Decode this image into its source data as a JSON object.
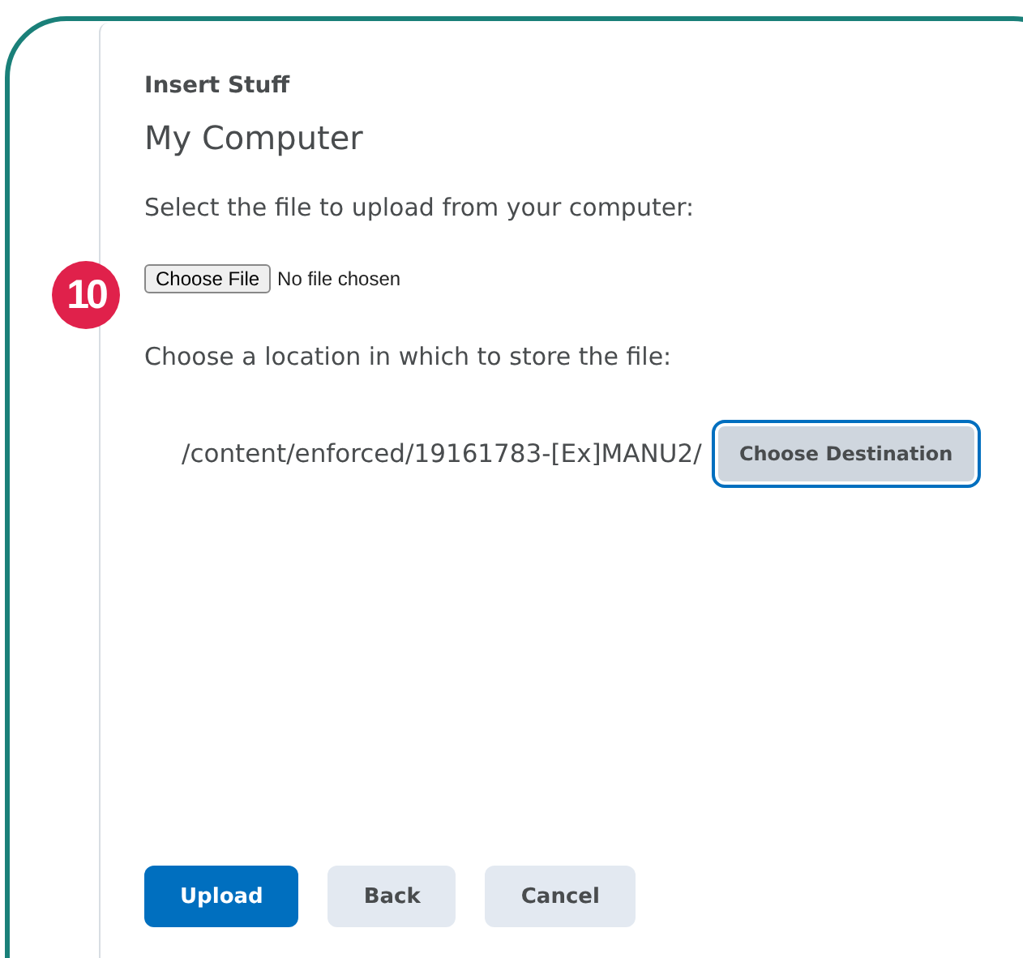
{
  "dialog": {
    "title": "Insert Stuff",
    "heading": "My Computer"
  },
  "step_badge": "10",
  "file_prompt": "Select the file to upload from your computer:",
  "file_input": {
    "button": "Choose File",
    "status": "No file chosen"
  },
  "location_prompt": "Choose a location in which to store the file:",
  "destination": {
    "path": "/content/enforced/19161783-[Ex]MANU2/",
    "button": "Choose Destination",
    "focused": true
  },
  "buttons": [
    {
      "label": "Upload",
      "kind": "primary"
    },
    {
      "label": "Back",
      "kind": "secondary"
    },
    {
      "label": "Cancel",
      "kind": "secondary"
    }
  ]
}
